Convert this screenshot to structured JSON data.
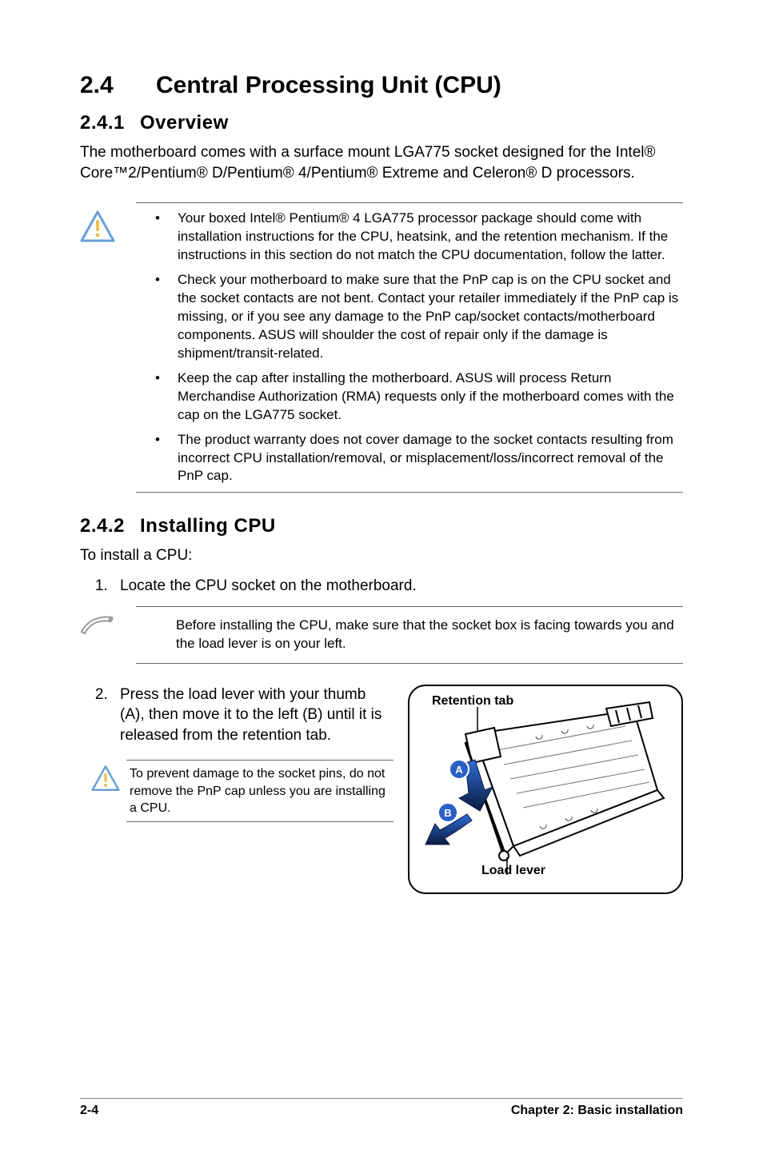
{
  "header": {
    "number": "2.4",
    "title": "Central Processing Unit (CPU)"
  },
  "s1": {
    "number": "2.4.1",
    "title": "Overview",
    "body": "The motherboard comes with a surface mount LGA775 socket designed for the Intel® Core™2/Pentium® D/Pentium® 4/Pentium® Extreme and Celeron®  D processors."
  },
  "caution1": {
    "b1": "Your boxed Intel® Pentium® 4 LGA775 processor package should come with installation instructions for the CPU, heatsink, and the retention mechanism. If the instructions in this section do not match the CPU documentation, follow the latter.",
    "b2": "Check your motherboard to make sure that the PnP cap is on the CPU socket and the socket contacts are not bent. Contact your retailer immediately if the PnP cap is missing, or if you see any damage to the PnP cap/socket contacts/motherboard components. ASUS will shoulder the cost of repair only if the damage is shipment/transit-related.",
    "b3": "Keep the cap after installing the motherboard. ASUS will process Return Merchandise Authorization (RMA) requests only if the motherboard comes with the cap on the LGA775 socket.",
    "b4": "The product warranty does not cover damage to the socket contacts resulting from incorrect CPU installation/removal, or misplacement/loss/incorrect removal of the PnP cap."
  },
  "s2": {
    "number": "2.4.2",
    "title": "Installing CPU",
    "intro": "To install a CPU:",
    "step1": "Locate the CPU socket on the motherboard.",
    "note1": "Before installing the CPU, make sure that the socket box is facing towards you and the load lever is on your left.",
    "step2": "Press the load lever with your thumb (A), then move it to the left (B) until it is released from the retention tab.",
    "caution2": "To prevent damage to the socket pins, do not remove the PnP cap unless you are installing a CPU."
  },
  "figure": {
    "label_top": "Retention tab",
    "label_bottom": "Load lever",
    "badge_a": "A",
    "badge_b": "B"
  },
  "footer": {
    "left": "2-4",
    "right": "Chapter 2: Basic installation"
  },
  "icons": {
    "caution": "caution-triangle-icon",
    "note": "pencil-note-icon"
  }
}
